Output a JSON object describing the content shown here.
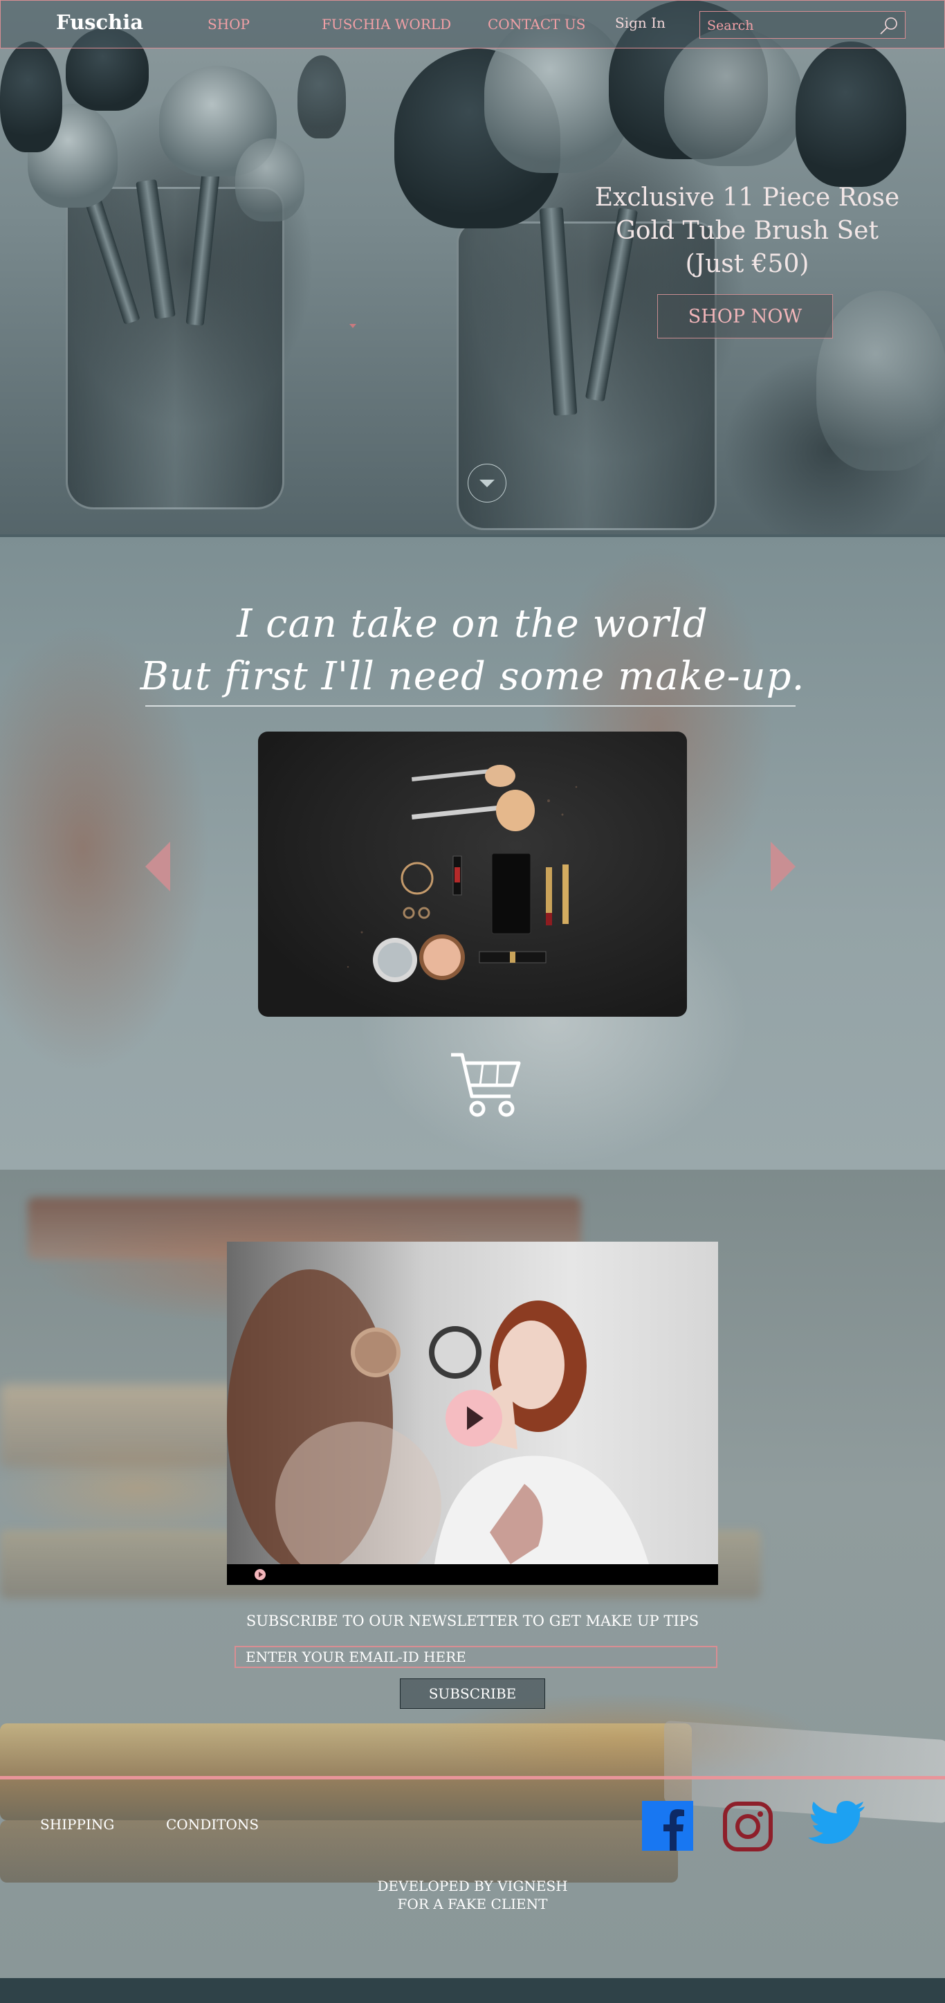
{
  "nav": {
    "logo": "Fuschia",
    "links": [
      "SHOP",
      "FUSCHIA WORLD",
      "CONTACT US"
    ],
    "sign_in": "Sign In",
    "search_placeholder": "Search"
  },
  "hero": {
    "title_line1": "Exclusive 11 Piece Rose",
    "title_line2": "Gold Tube Brush Set",
    "title_line3": "(Just €50)",
    "cta": "SHOP NOW"
  },
  "quote": {
    "line1": "I can take on the world",
    "line2": "But first I'll need some make-up."
  },
  "newsletter": {
    "label": "SUBSCRIBE TO OUR NEWSLETTER TO GET MAKE UP TIPS",
    "placeholder": "ENTER YOUR EMAIL-ID HERE",
    "button": "SUBSCRIBE"
  },
  "footer": {
    "links": [
      "SHIPPING",
      "CONDITONS"
    ],
    "social": [
      "facebook-icon",
      "instagram-icon",
      "twitter-icon"
    ],
    "credit_line1": "DEVELOPED BY VIGNESH",
    "credit_line2": "FOR A FAKE CLIENT"
  },
  "colors": {
    "accent": "#e8959a",
    "nav_text": "#f2a0a6",
    "facebook": "#1877f2",
    "instagram": "#8e1f2a",
    "twitter": "#1da1f2"
  }
}
